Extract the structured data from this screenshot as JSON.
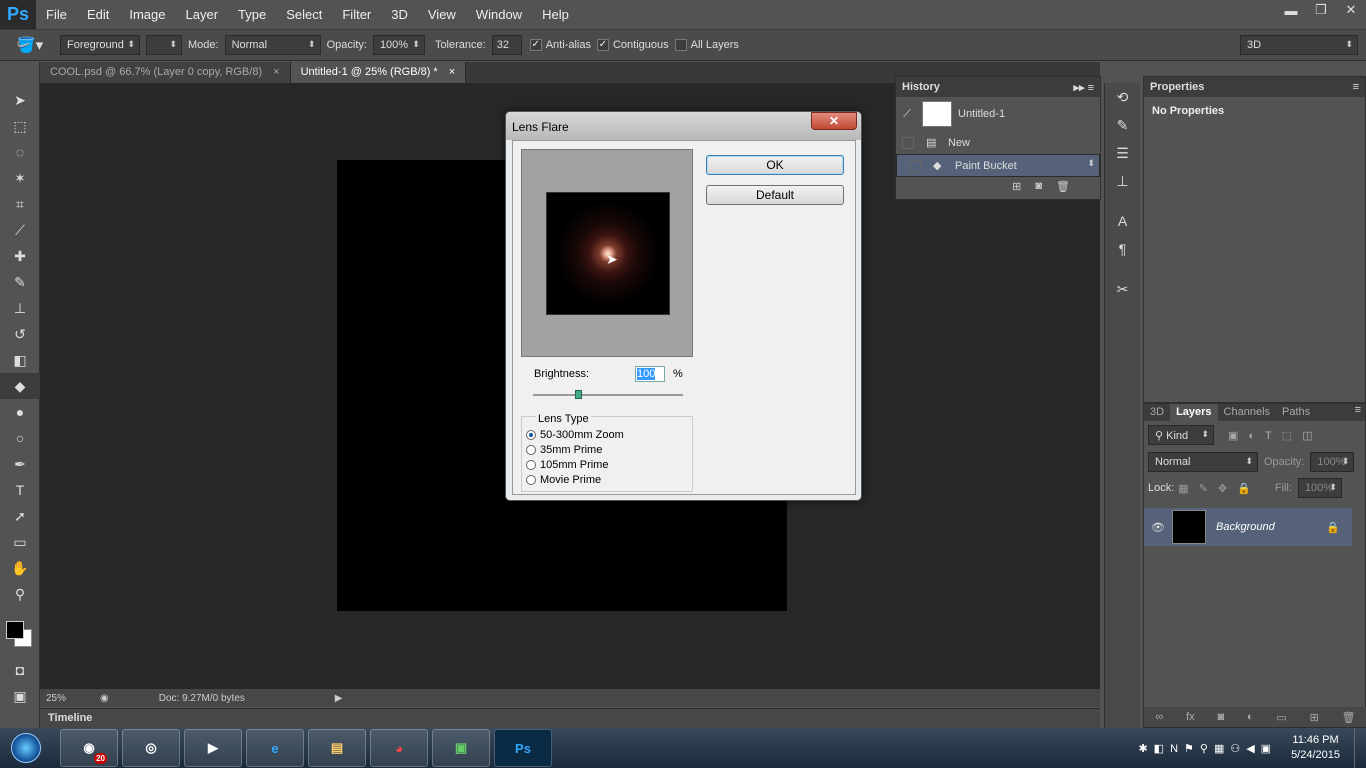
{
  "app": {
    "logo": "Ps"
  },
  "menu": [
    "File",
    "Edit",
    "Image",
    "Layer",
    "Type",
    "Select",
    "Filter",
    "3D",
    "View",
    "Window",
    "Help"
  ],
  "window_buttons": {
    "minimize": "▬",
    "restore": "❐",
    "close": "✕"
  },
  "options_bar": {
    "tool_icon": "paint-bucket-icon",
    "fill_source": "Foreground",
    "mode_label": "Mode:",
    "mode_value": "Normal",
    "opacity_label": "Opacity:",
    "opacity_value": "100%",
    "tolerance_label": "Tolerance:",
    "tolerance_value": "32",
    "anti_alias_label": "Anti-alias",
    "anti_alias": true,
    "contiguous_label": "Contiguous",
    "contiguous": true,
    "all_layers_label": "All Layers",
    "all_layers": false,
    "workspace": "3D"
  },
  "doc_tabs": [
    {
      "label": "COOL.psd @ 66.7% (Layer 0 copy, RGB/8)",
      "close": "×",
      "active": false
    },
    {
      "label": "Untitled-1 @ 25% (RGB/8) *",
      "close": "×",
      "active": true
    }
  ],
  "status": {
    "zoom": "25%",
    "doc": "Doc: 9.27M/0 bytes"
  },
  "timeline": {
    "label": "Timeline"
  },
  "dialog": {
    "title": "Lens Flare",
    "close": "✕",
    "ok_label": "OK",
    "default_label": "Default",
    "brightness_label": "Brightness:",
    "brightness_value": "100",
    "brightness_unit": "%",
    "lens_type_label": "Lens Type",
    "lens_options": [
      "50-300mm Zoom",
      "35mm Prime",
      "105mm Prime",
      "Movie Prime"
    ],
    "lens_selected": 0
  },
  "history": {
    "title": "History",
    "snapshot": "Untitled-1",
    "items": [
      "New",
      "Paint Bucket"
    ],
    "selected": 1
  },
  "properties": {
    "title": "Properties",
    "empty_text": "No Properties"
  },
  "layers_panel": {
    "tabs": [
      "3D",
      "Layers",
      "Channels",
      "Paths"
    ],
    "active_tab": "Layers",
    "kind_label": "Kind",
    "blend_mode": "Normal",
    "opacity_label": "Opacity:",
    "opacity_value": "100%",
    "lock_label": "Lock:",
    "fill_label": "Fill:",
    "fill_value": "100%",
    "layers": [
      {
        "name": "Background",
        "visible": true,
        "locked": true
      }
    ]
  },
  "taskbar": {
    "apps": [
      "camera-icon",
      "circle-app-icon",
      "media-player-icon",
      "internet-explorer-icon",
      "file-explorer-icon",
      "chrome-icon",
      "monitor-icon",
      "photoshop-icon"
    ],
    "ps_label": "Ps",
    "camera_badge": "20",
    "time": "11:46 PM",
    "date": "5/24/2015"
  }
}
